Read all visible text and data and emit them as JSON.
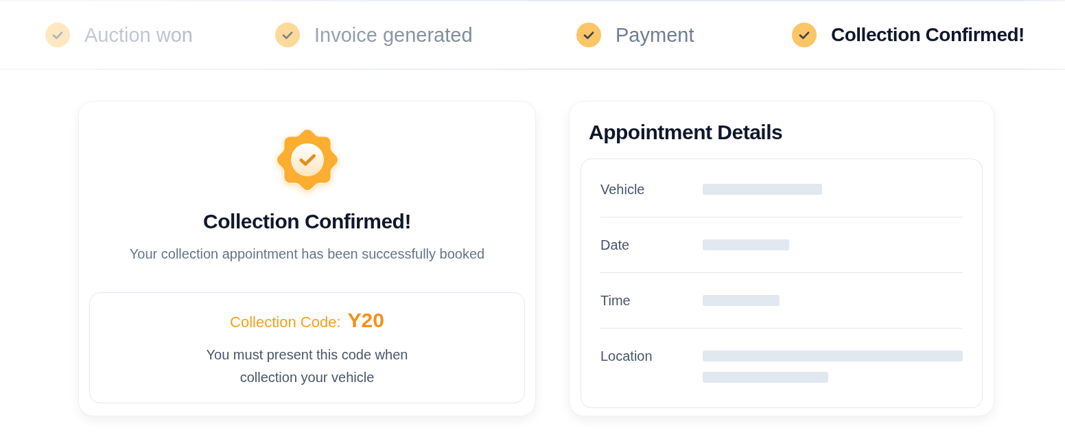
{
  "steps": [
    {
      "label": "Auction won",
      "completed": true,
      "current": false
    },
    {
      "label": "Invoice generated",
      "completed": true,
      "current": false
    },
    {
      "label": "Payment",
      "completed": true,
      "current": false
    },
    {
      "label": "Collection Confirmed!",
      "completed": true,
      "current": true
    }
  ],
  "confirmation": {
    "title": "Collection Confirmed!",
    "subtitle": "Your collection appointment has been successfully booked",
    "code": {
      "label": "Collection Code:",
      "value": "Y20",
      "note": "You must present this code when collection your vehicle"
    }
  },
  "appointment": {
    "title": "Appointment Details",
    "rows": [
      {
        "label": "Vehicle",
        "loading": true
      },
      {
        "label": "Date",
        "loading": true
      },
      {
        "label": "Time",
        "loading": true
      },
      {
        "label": "Location",
        "loading": true
      }
    ]
  }
}
